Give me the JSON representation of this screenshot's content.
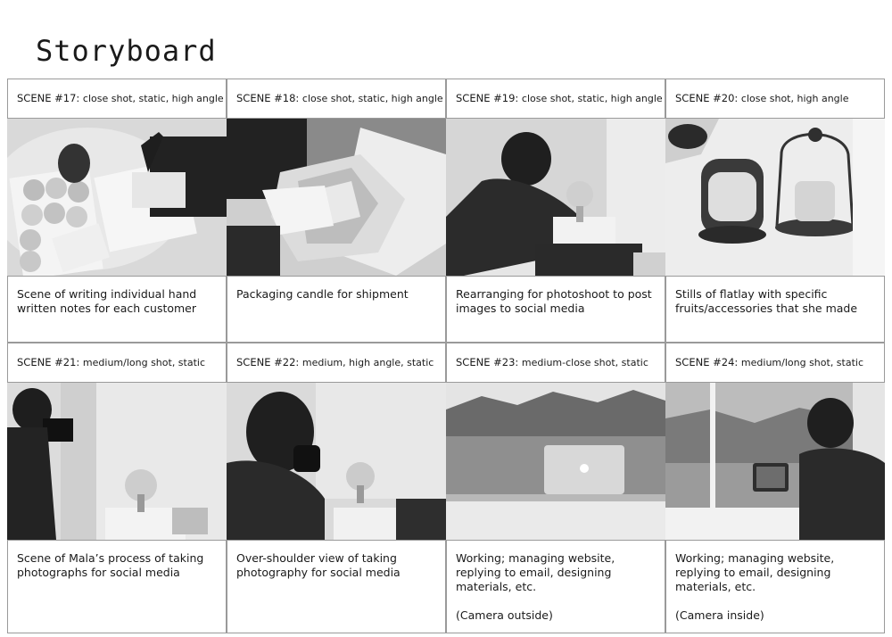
{
  "title": "Storyboard",
  "scenes": [
    {
      "num": "SCENE #17:",
      "shot": "close shot, static, high angle",
      "caption": "Scene of writing individual hand written notes for each customer",
      "image": "writing-notes-photo"
    },
    {
      "num": "SCENE #18:",
      "shot": "close shot, static, high angle",
      "caption": "Packaging candle for shipment",
      "image": "packaging-candle-photo"
    },
    {
      "num": "SCENE #19:",
      "shot": "close shot, static, high angle",
      "caption": "Rearranging for photoshoot to post images to social media",
      "image": "rearranging-photoshoot-photo"
    },
    {
      "num": "SCENE #20:",
      "shot": "close shot, high angle",
      "caption": "Stills of flatlay with specific fruits/accessories that she made",
      "image": "flatlay-candle-photo"
    },
    {
      "num": "SCENE #21:",
      "shot": "medium/long shot, static",
      "caption": "Scene of Mala’s process of taking photographs for social media",
      "image": "taking-photographs-photo"
    },
    {
      "num": "SCENE #22:",
      "shot": "medium, high angle, static",
      "caption": "Over-shoulder view of taking photography for social media",
      "image": "over-shoulder-photo"
    },
    {
      "num": "SCENE #23:",
      "shot": "medium-close shot, static",
      "caption": "Working; managing website, replying to email, designing materials, etc.\n\n(Camera outside)",
      "image": "laptop-window-outside-photo"
    },
    {
      "num": "SCENE #24:",
      "shot": "medium/long shot, static",
      "caption": "Working; managing website, replying to email, designing materials, etc.\n\n(Camera inside)",
      "image": "laptop-window-inside-photo"
    }
  ]
}
